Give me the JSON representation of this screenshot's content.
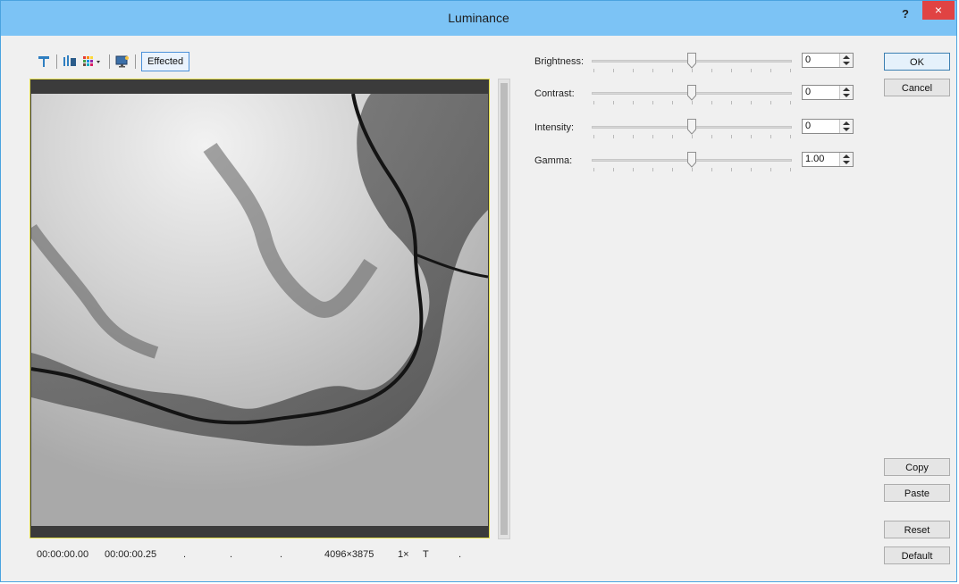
{
  "window": {
    "title": "Luminance",
    "help_label": "?",
    "close_label": "×"
  },
  "toolbar": {
    "effected_label": "Effected",
    "icons": [
      "filter-icon",
      "channels-icon",
      "palette-dropdown-icon",
      "monitor-icon"
    ]
  },
  "preview": {
    "image_description_key": "grayscale-heightmap"
  },
  "status": {
    "time_start": "00:00:00.00",
    "time_end": "00:00:00.25",
    "dot1": ".",
    "dot2": ".",
    "dot3": ".",
    "resolution": "4096×3875",
    "zoom": "1×",
    "field": "T",
    "dot4": "."
  },
  "sliders": [
    {
      "label": "Brightness:",
      "value": "0",
      "position": 0.5
    },
    {
      "label": "Contrast:",
      "value": "0",
      "position": 0.5
    },
    {
      "label": "Intensity:",
      "value": "0",
      "position": 0.5
    },
    {
      "label": "Gamma:",
      "value": "1.00",
      "position": 0.5
    }
  ],
  "buttons": {
    "ok": "OK",
    "cancel": "Cancel",
    "copy": "Copy",
    "paste": "Paste",
    "reset": "Reset",
    "default": "Default"
  }
}
